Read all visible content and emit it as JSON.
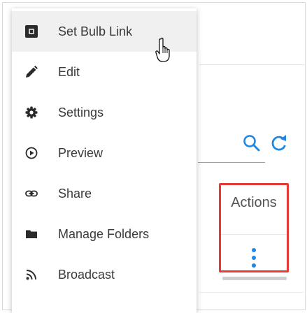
{
  "menu": {
    "items": [
      {
        "label": "Set Bulb Link",
        "icon": "bulb-link-icon"
      },
      {
        "label": "Edit",
        "icon": "pencil-icon"
      },
      {
        "label": "Settings",
        "icon": "gear-icon"
      },
      {
        "label": "Preview",
        "icon": "play-circle-icon"
      },
      {
        "label": "Share",
        "icon": "link-icon"
      },
      {
        "label": "Manage Folders",
        "icon": "folder-icon"
      },
      {
        "label": "Broadcast",
        "icon": "rss-icon"
      }
    ]
  },
  "table": {
    "actions_header": "Actions"
  },
  "colors": {
    "highlight_border": "#e53935",
    "accent": "#1e88e5",
    "hover_bg": "#f0f0f0"
  }
}
